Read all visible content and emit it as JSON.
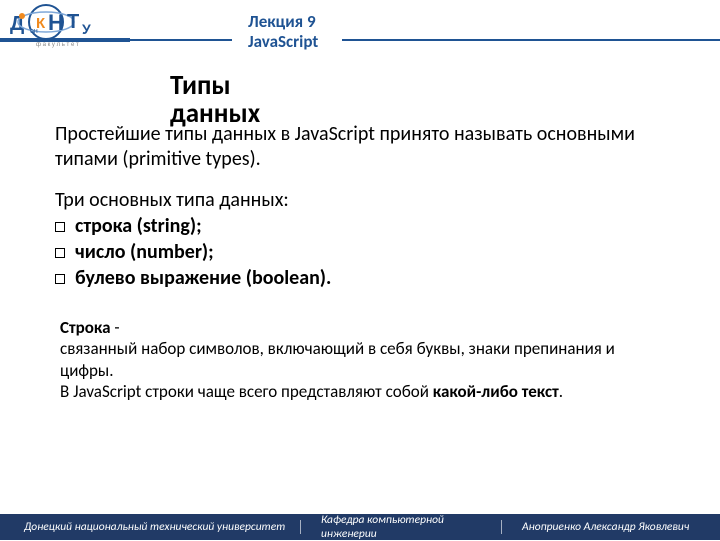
{
  "header": {
    "lecture": "Лекция 9",
    "subject": "JavaScript"
  },
  "section_title_line1": "Типы",
  "section_title_line2": "данных",
  "intro": "Простейшие типы данных в JavaScript принято называть основными типами (primitive types).",
  "three_types_heading": "Три основных типа данных:",
  "types_list": [
    "строка (string);",
    "число (number);",
    "булево выражение (boolean)."
  ],
  "string_block": {
    "label": "Строка",
    "dash": "-",
    "definition": "связанный набор символов, включающий в себя буквы, знаки препинания и цифры.",
    "line2_prefix": "В JavaScript строки чаще всего представляют собой ",
    "line2_bold": "какой-либо текст",
    "line2_suffix": "."
  },
  "footer": {
    "left": "Донецкий национальный технический университет",
    "mid": "Кафедра компьютерной инженерии",
    "right": "Аноприенко Александр Яковлевич"
  },
  "colors": {
    "accent": "#1f5393",
    "footer": "#213a66"
  }
}
